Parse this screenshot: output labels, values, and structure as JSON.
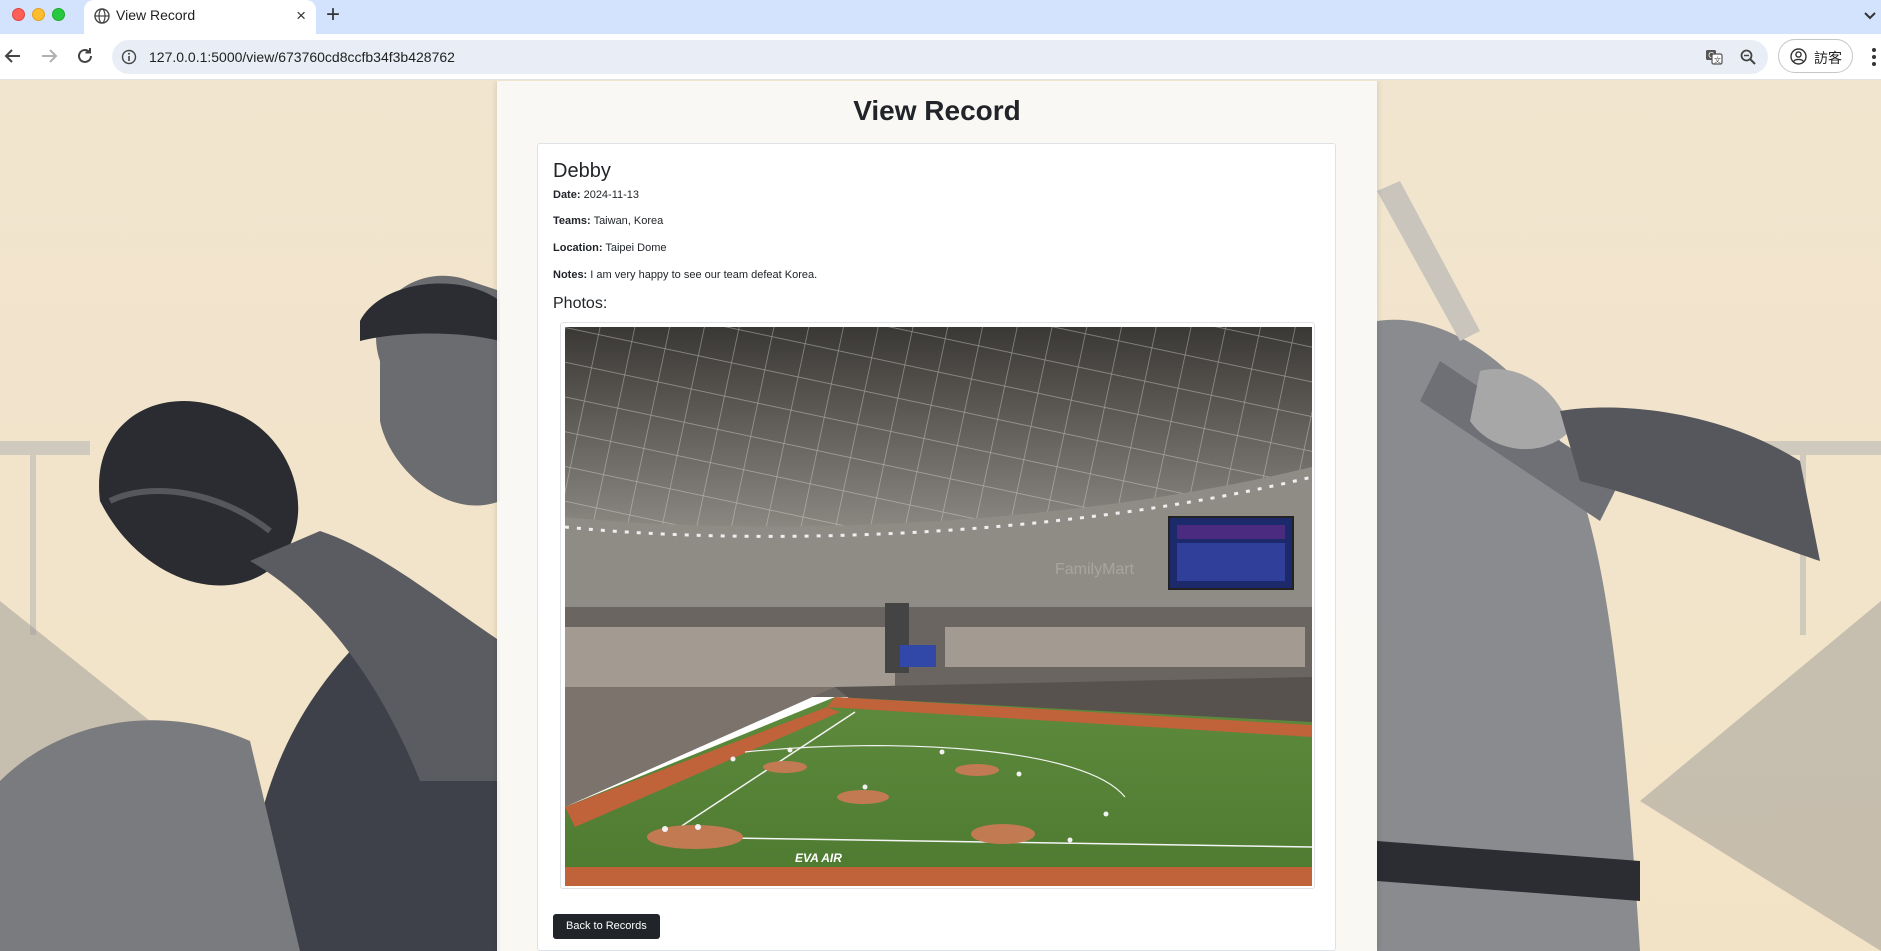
{
  "browser": {
    "tab_title": "View Record",
    "url": "127.0.0.1:5000/view/673760cd8ccfb34f3b428762",
    "profile_label": "訪客",
    "new_tab_glyph": "+",
    "close_glyph": "×"
  },
  "page": {
    "title": "View Record",
    "record": {
      "name": "Debby",
      "date_label": "Date:",
      "date": "2024-11-13",
      "teams_label": "Teams:",
      "teams": "Taiwan, Korea",
      "location_label": "Location:",
      "location": "Taipei Dome",
      "notes_label": "Notes:",
      "notes": "I am very happy to see our team defeat Korea."
    },
    "photos_label": "Photos:",
    "photo": {
      "board_text": "FamilyMart",
      "field_text": "EVA AIR"
    },
    "back_button_label": "Back to Records"
  },
  "colors": {
    "accent_dark_button": "#212529",
    "tab_strip": "#d3e3fd",
    "page_background": "#f1e4cc"
  },
  "icons": [
    "globe-icon",
    "back-arrow-icon",
    "forward-arrow-icon",
    "reload-icon",
    "info-icon",
    "translate-icon",
    "zoom-icon",
    "profile-icon",
    "kebab-menu-icon",
    "chevron-down-icon"
  ]
}
